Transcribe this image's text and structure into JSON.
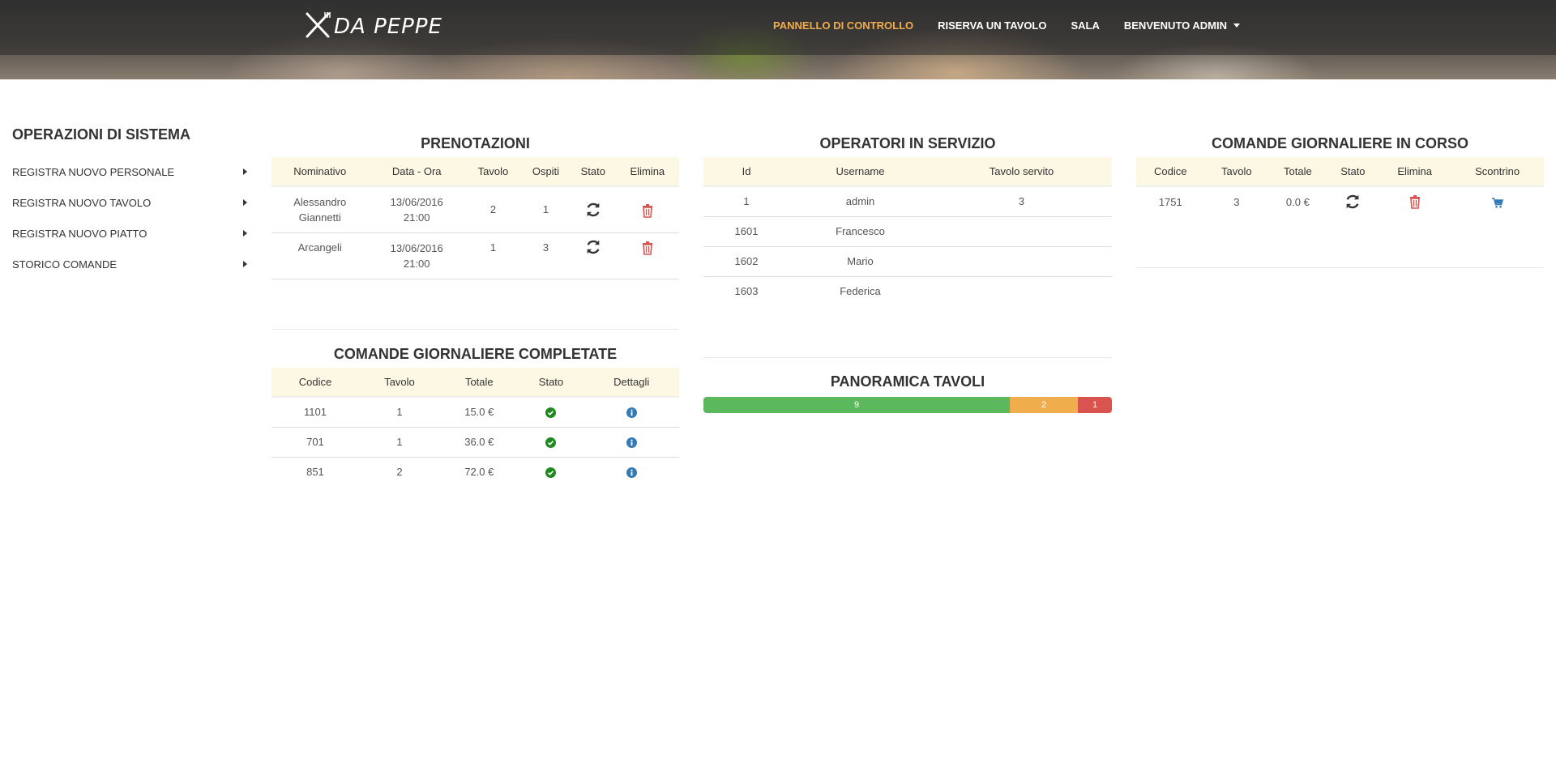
{
  "brand": {
    "name": "DA PEPPE"
  },
  "nav": {
    "items": [
      {
        "label": "PANNELLO DI CONTROLLO",
        "active": true
      },
      {
        "label": "RISERVA UN TAVOLO",
        "active": false
      },
      {
        "label": "SALA",
        "active": false
      },
      {
        "label": "BENVENUTO ADMIN",
        "active": false,
        "dropdown": true
      }
    ]
  },
  "sidebar": {
    "title": "OPERAZIONI DI SISTEMA",
    "items": [
      {
        "label": "REGISTRA NUOVO PERSONALE"
      },
      {
        "label": "REGISTRA NUOVO TAVOLO"
      },
      {
        "label": "REGISTRA NUOVO PIATTO"
      },
      {
        "label": "STORICO COMANDE"
      }
    ]
  },
  "prenotazioni": {
    "title": "PRENOTAZIONI",
    "headers": [
      "Nominativo",
      "Data - Ora",
      "Tavolo",
      "Ospiti",
      "Stato",
      "Elimina"
    ],
    "rows": [
      {
        "nominativo_1": "Alessandro",
        "nominativo_2": "Giannetti",
        "data": "13/06/2016",
        "ora": "21:00",
        "tavolo": "2",
        "ospiti": "1"
      },
      {
        "nominativo_1": "Arcangeli",
        "nominativo_2": "",
        "data": "13/06/2016",
        "ora": "21:00",
        "tavolo": "1",
        "ospiti": "3"
      }
    ]
  },
  "operatori": {
    "title": "OPERATORI IN SERVIZIO",
    "headers": [
      "Id",
      "Username",
      "Tavolo servito"
    ],
    "rows": [
      {
        "id": "1",
        "username": "admin",
        "tavolo": "3"
      },
      {
        "id": "1601",
        "username": "Francesco",
        "tavolo": ""
      },
      {
        "id": "1602",
        "username": "Mario",
        "tavolo": ""
      },
      {
        "id": "1603",
        "username": "Federica",
        "tavolo": ""
      }
    ]
  },
  "comande_in_corso": {
    "title": "COMANDE GIORNALIERE IN CORSO",
    "headers": [
      "Codice",
      "Tavolo",
      "Totale",
      "Stato",
      "Elimina",
      "Scontrino"
    ],
    "rows": [
      {
        "codice": "1751",
        "tavolo": "3",
        "totale": "0.0 €"
      }
    ]
  },
  "comande_completate": {
    "title": "COMANDE GIORNALIERE COMPLETATE",
    "headers": [
      "Codice",
      "Tavolo",
      "Totale",
      "Stato",
      "Dettagli"
    ],
    "rows": [
      {
        "codice": "1101",
        "tavolo": "1",
        "totale": "15.0 €"
      },
      {
        "codice": "701",
        "tavolo": "1",
        "totale": "36.0 €"
      },
      {
        "codice": "851",
        "tavolo": "2",
        "totale": "72.0 €"
      }
    ]
  },
  "panoramica": {
    "title": "PANORAMICA TAVOLI",
    "segments": [
      {
        "label": "9",
        "value": 9,
        "color": "#5cb85c"
      },
      {
        "label": "2",
        "value": 2,
        "color": "#f0ad4e"
      },
      {
        "label": "1",
        "value": 1,
        "color": "#d9534f"
      }
    ]
  },
  "colors": {
    "accent": "#f0ad4e",
    "header_row": "#fcf8e3",
    "danger": "#d9534f",
    "success": "#1e8a1e",
    "info": "#337ab7"
  }
}
